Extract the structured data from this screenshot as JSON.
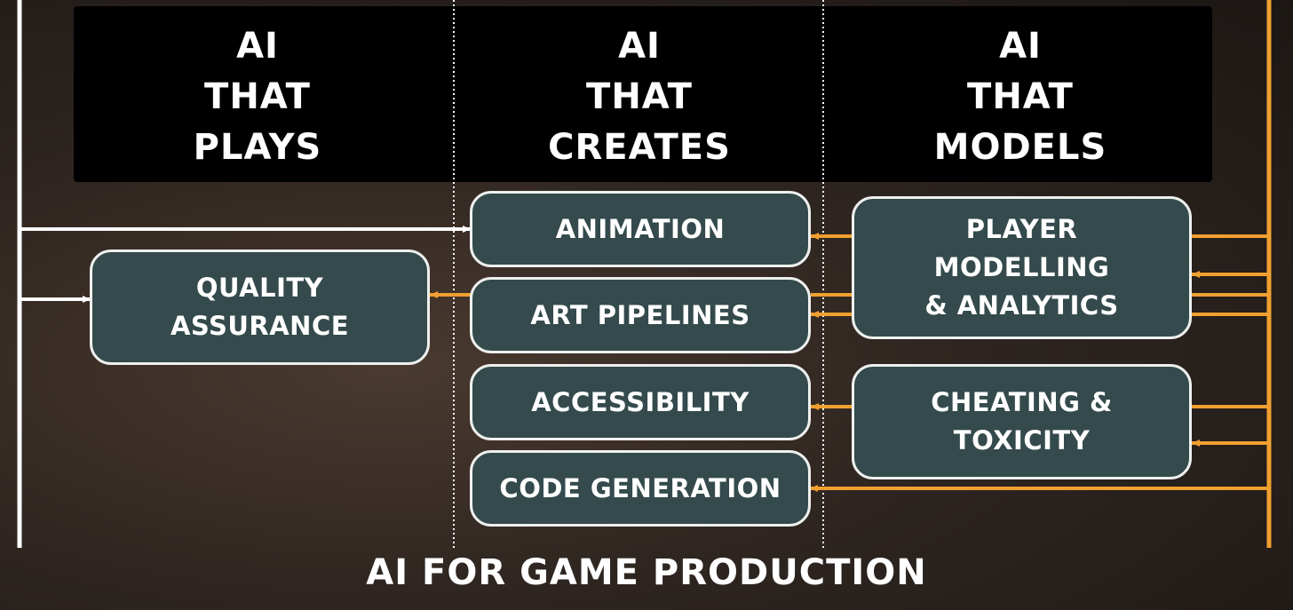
{
  "columns": [
    {
      "id": "plays",
      "title_lines": [
        "AI",
        "THAT",
        "PLAYS"
      ]
    },
    {
      "id": "creates",
      "title_lines": [
        "AI",
        "THAT",
        "CREATES"
      ]
    },
    {
      "id": "models",
      "title_lines": [
        "AI",
        "THAT",
        "MODELS"
      ]
    }
  ],
  "nodes": {
    "quality_assurance": [
      "QUALITY",
      "ASSURANCE"
    ],
    "animation": [
      "ANIMATION"
    ],
    "art_pipelines": [
      "ART PIPELINES"
    ],
    "accessibility": [
      "ACCESSIBILITY"
    ],
    "code_generation": [
      "CODE GENERATION"
    ],
    "player_modelling": [
      "PLAYER",
      "MODELLING",
      "& ANALYTICS"
    ],
    "cheating_toxicity": [
      "CHEATING &",
      "TOXICITY"
    ]
  },
  "edges": [
    {
      "from": "plays",
      "to": "animation",
      "color": "white"
    },
    {
      "from": "plays",
      "to": "quality_assurance",
      "color": "white"
    },
    {
      "from": "art_pipelines",
      "to": "quality_assurance",
      "color": "orange"
    },
    {
      "from": "player_modelling",
      "to": "animation",
      "color": "orange"
    },
    {
      "from": "player_modelling",
      "to": "art_pipelines",
      "color": "orange"
    },
    {
      "from": "cheating_toxicity",
      "to": "accessibility",
      "color": "orange"
    },
    {
      "from": "models",
      "to": "code_generation",
      "color": "orange"
    },
    {
      "from": "models",
      "to": "player_modelling",
      "color": "orange"
    },
    {
      "from": "models",
      "to": "cheating_toxicity",
      "color": "orange"
    }
  ],
  "footer": "AI FOR GAME PRODUCTION",
  "colors": {
    "header_background": "#000000",
    "box_fill": "#344a4c",
    "box_border": "#eef0ee",
    "white_line": "#ffffff",
    "orange_line": "#f0a030",
    "text": "#ffffff"
  }
}
